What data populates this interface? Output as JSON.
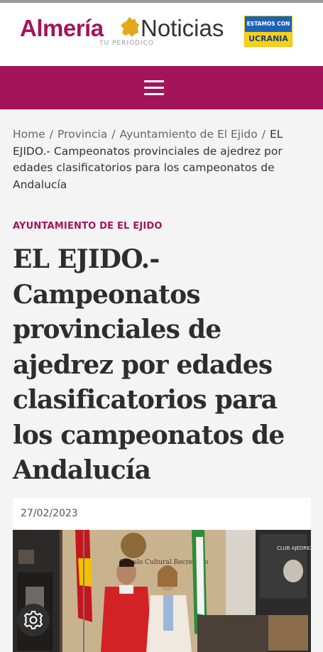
{
  "header": {
    "logo_part1": "Almería",
    "logo_part2": "Noticias",
    "logo_tagline": "TU PERIÓDICO",
    "banner_top": "ESTAMOS CON",
    "banner_bottom": "UCRANIA"
  },
  "breadcrumb": {
    "items": [
      "Home",
      "Provincia",
      "Ayuntamiento de El Ejido"
    ],
    "current": "EL EJIDO.- Campeonatos provinciales de ajedrez por edades clasificatorios para los campeonatos de Andalucía"
  },
  "article": {
    "category": "AYUNTAMIENTO DE EL EJIDO",
    "title": "EL EJIDO.- Campeonatos provinciales de ajedrez por edades clasificatorios para los campeonatos de Andalucía",
    "date": "27/02/2023"
  },
  "photo": {
    "banner_text": "CLUB AJEDREZ EJIDO",
    "wall_text": "Circulo Cultural Recreativo"
  },
  "colors": {
    "brand": "#a4145a",
    "background": "#f4f4f4",
    "ukraine_blue": "#1c63b7",
    "ukraine_yellow": "#f7d117"
  },
  "icons": {
    "menu": "hamburger-menu-icon",
    "settings": "gear-icon",
    "logo_map": "almeria-map-icon"
  }
}
